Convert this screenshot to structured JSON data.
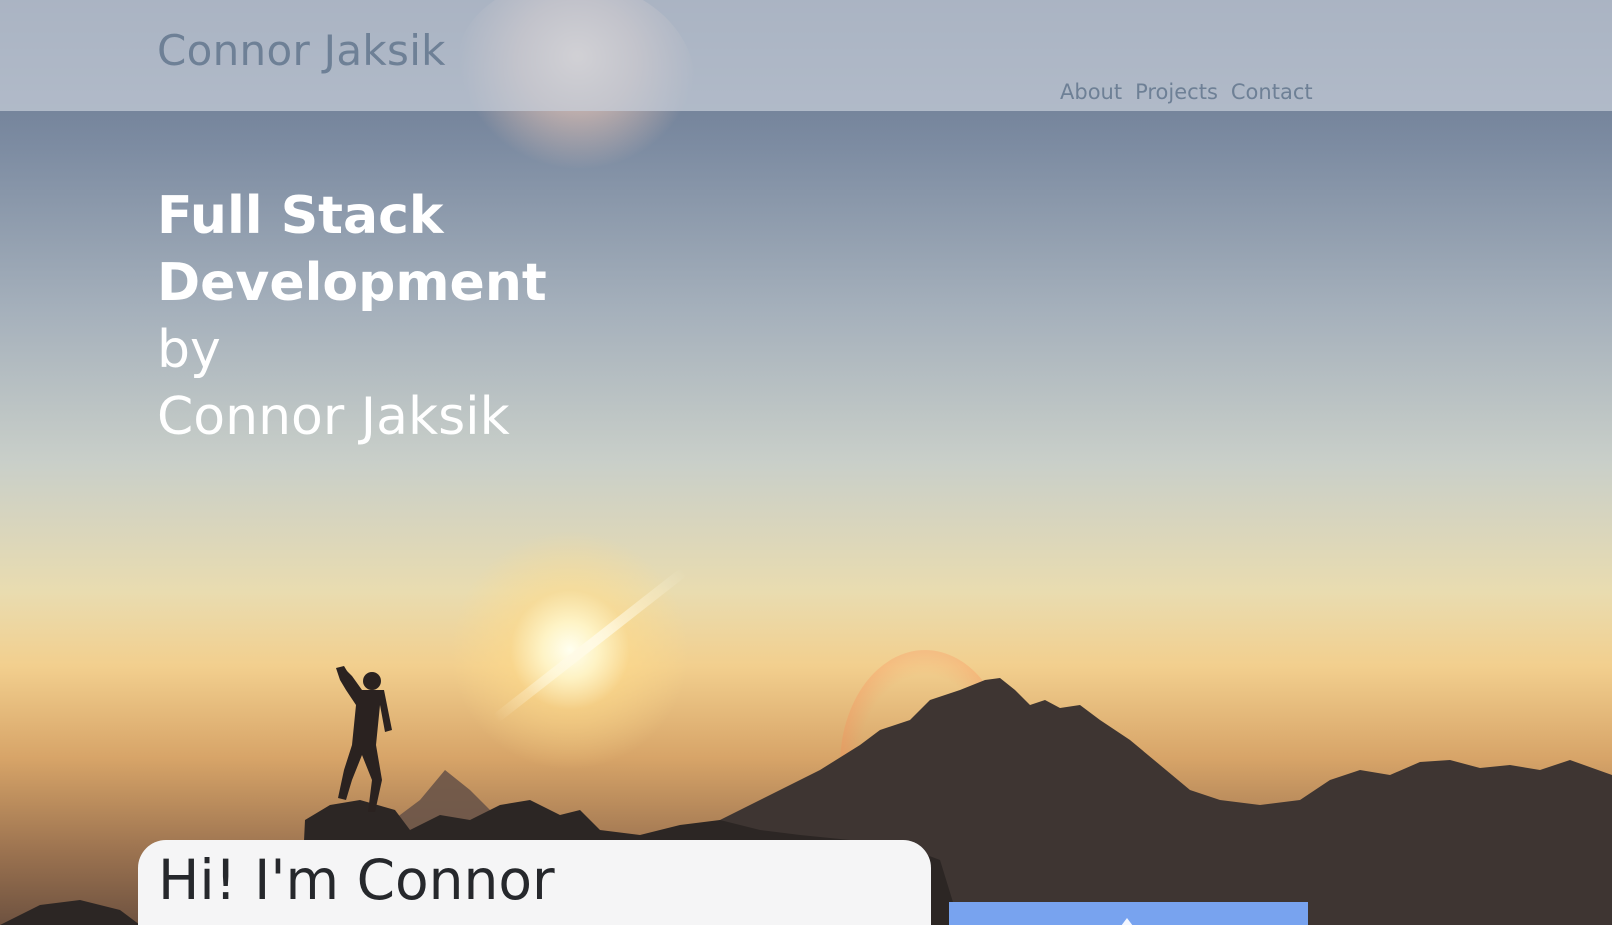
{
  "header": {
    "brand": "Connor Jaksik",
    "nav": [
      {
        "label": "About"
      },
      {
        "label": "Projects"
      },
      {
        "label": "Contact"
      }
    ]
  },
  "hero": {
    "lines": [
      "Full Stack",
      "Development",
      "by",
      "Connor Jaksik"
    ]
  },
  "intro": {
    "title": "Hi! I'm Connor"
  },
  "colors": {
    "header_text": "#6e8096",
    "hero_text": "#ffffff",
    "card_background": "#f5f5f6",
    "photo_accent": "#78a3ef"
  }
}
